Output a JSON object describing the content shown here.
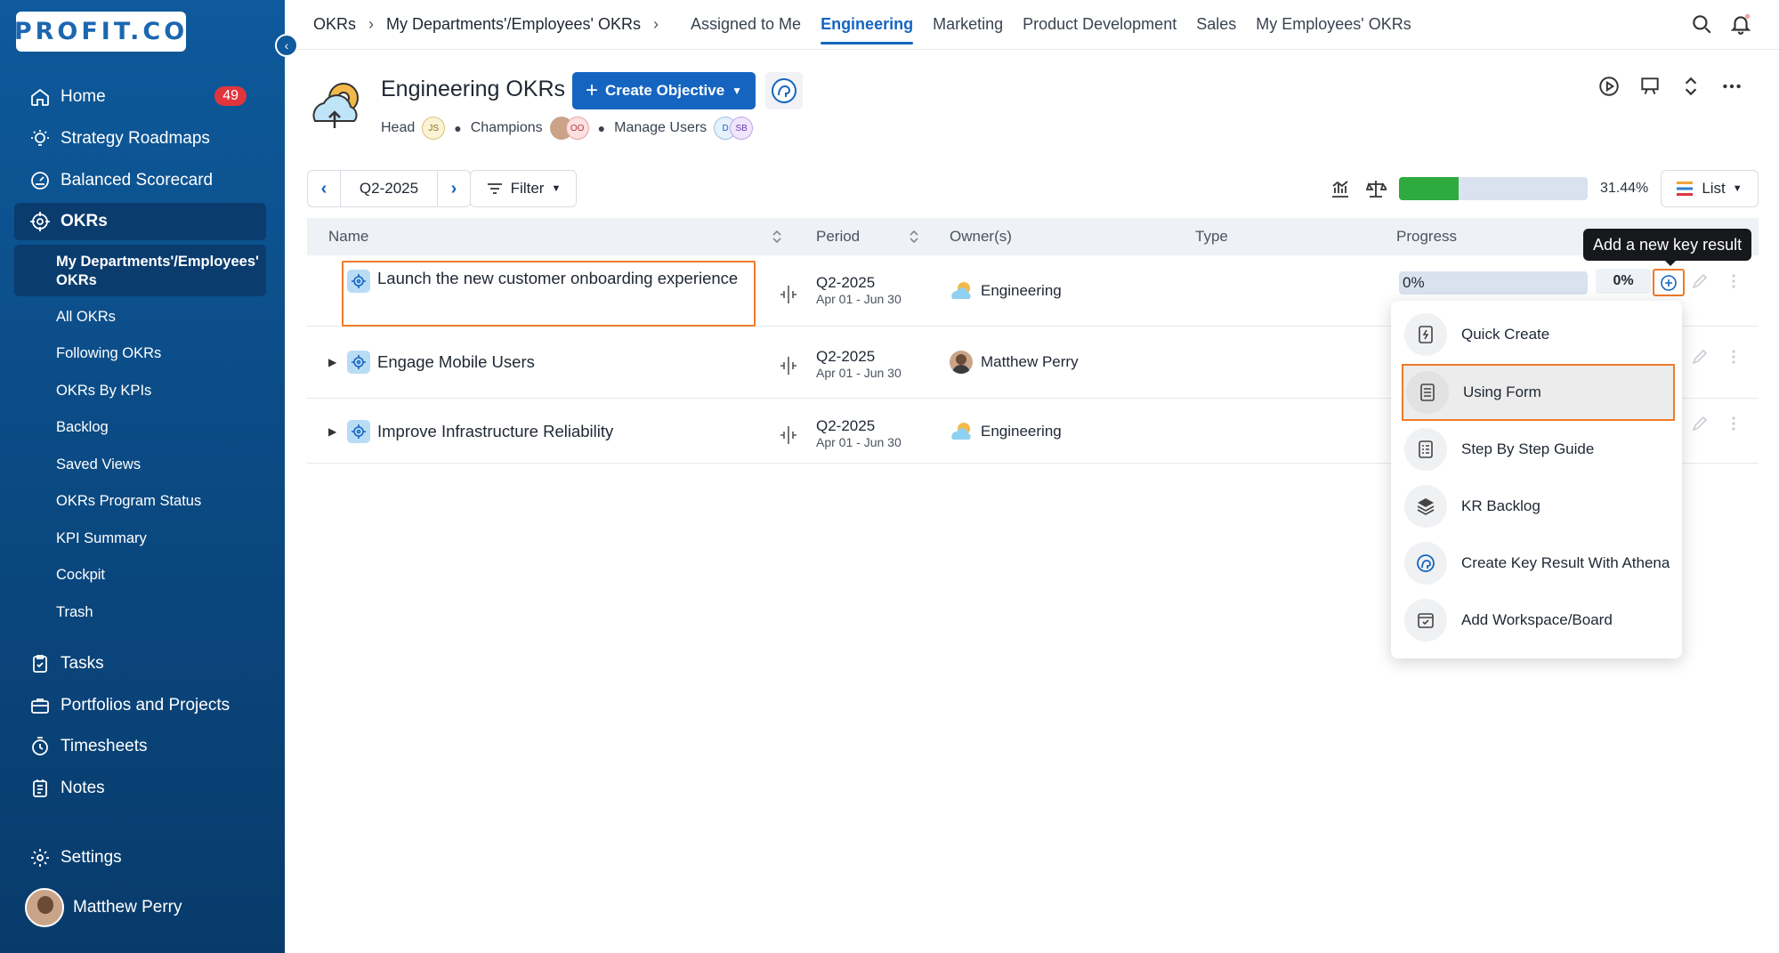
{
  "sidebar": {
    "logo_text": "PROFIT.CO",
    "home": "Home",
    "home_badge": "49",
    "strategy": "Strategy Roadmaps",
    "scorecard": "Balanced Scorecard",
    "okrs": "OKRs",
    "sub_items": {
      "my_departments": "My Departments'/Employees' OKRs",
      "all": "All OKRs",
      "following": "Following OKRs",
      "by_kpis": "OKRs By KPIs",
      "backlog": "Backlog",
      "saved_views": "Saved Views",
      "program_status": "OKRs Program Status",
      "kpi_summary": "KPI Summary",
      "cockpit": "Cockpit",
      "trash": "Trash"
    },
    "tasks": "Tasks",
    "portfolios": "Portfolios and Projects",
    "timesheets": "Timesheets",
    "notes": "Notes",
    "settings": "Settings",
    "user_name": "Matthew Perry"
  },
  "topbar": {
    "crumb_1": "OKRs",
    "crumb_2": "My Departments'/Employees' OKRs",
    "separator": "›",
    "tabs": {
      "assigned": "Assigned to Me",
      "engineering": "Engineering",
      "marketing": "Marketing",
      "product": "Product Development",
      "sales": "Sales",
      "employees": "My Employees' OKRs"
    }
  },
  "header": {
    "title": "Engineering OKRs",
    "create_label": "Create Objective",
    "head_label": "Head",
    "head_initials": "JS",
    "champions_label": "Champions",
    "champions_initials": "OO",
    "manage_users_label": "Manage Users",
    "manage_initials_1": "D",
    "manage_initials_2": "SB"
  },
  "toolbar": {
    "period": "Q2-2025",
    "filter": "Filter",
    "overall_progress": 31.44,
    "overall_progress_label": "31.44%",
    "view": "List"
  },
  "table": {
    "columns": {
      "name": "Name",
      "period": "Period",
      "owners": "Owner(s)",
      "type": "Type",
      "progress": "Progress"
    },
    "rows": [
      {
        "name": "Launch the new customer onboarding experience",
        "period": "Q2-2025",
        "range": "Apr 01 - Jun 30",
        "owner": "Engineering",
        "progress": "0%",
        "pct": "0%"
      },
      {
        "name": "Engage Mobile Users",
        "period": "Q2-2025",
        "range": "Apr 01 - Jun 30",
        "owner": "Matthew Perry"
      },
      {
        "name": "Improve Infrastructure Reliability",
        "period": "Q2-2025",
        "range": "Apr 01 - Jun 30",
        "owner": "Engineering"
      }
    ]
  },
  "tooltip": "Add a new key result",
  "menu": {
    "quick_create": "Quick Create",
    "using_form": "Using Form",
    "step_by_step": "Step By Step Guide",
    "kr_backlog": "KR Backlog",
    "athena": "Create Key Result With Athena",
    "workspace": "Add Workspace/Board"
  },
  "colors": {
    "accent": "#1565c0",
    "sidebar": "#0b4b85",
    "highlight": "#ef7a2a",
    "progress": "#2eaa3f"
  }
}
